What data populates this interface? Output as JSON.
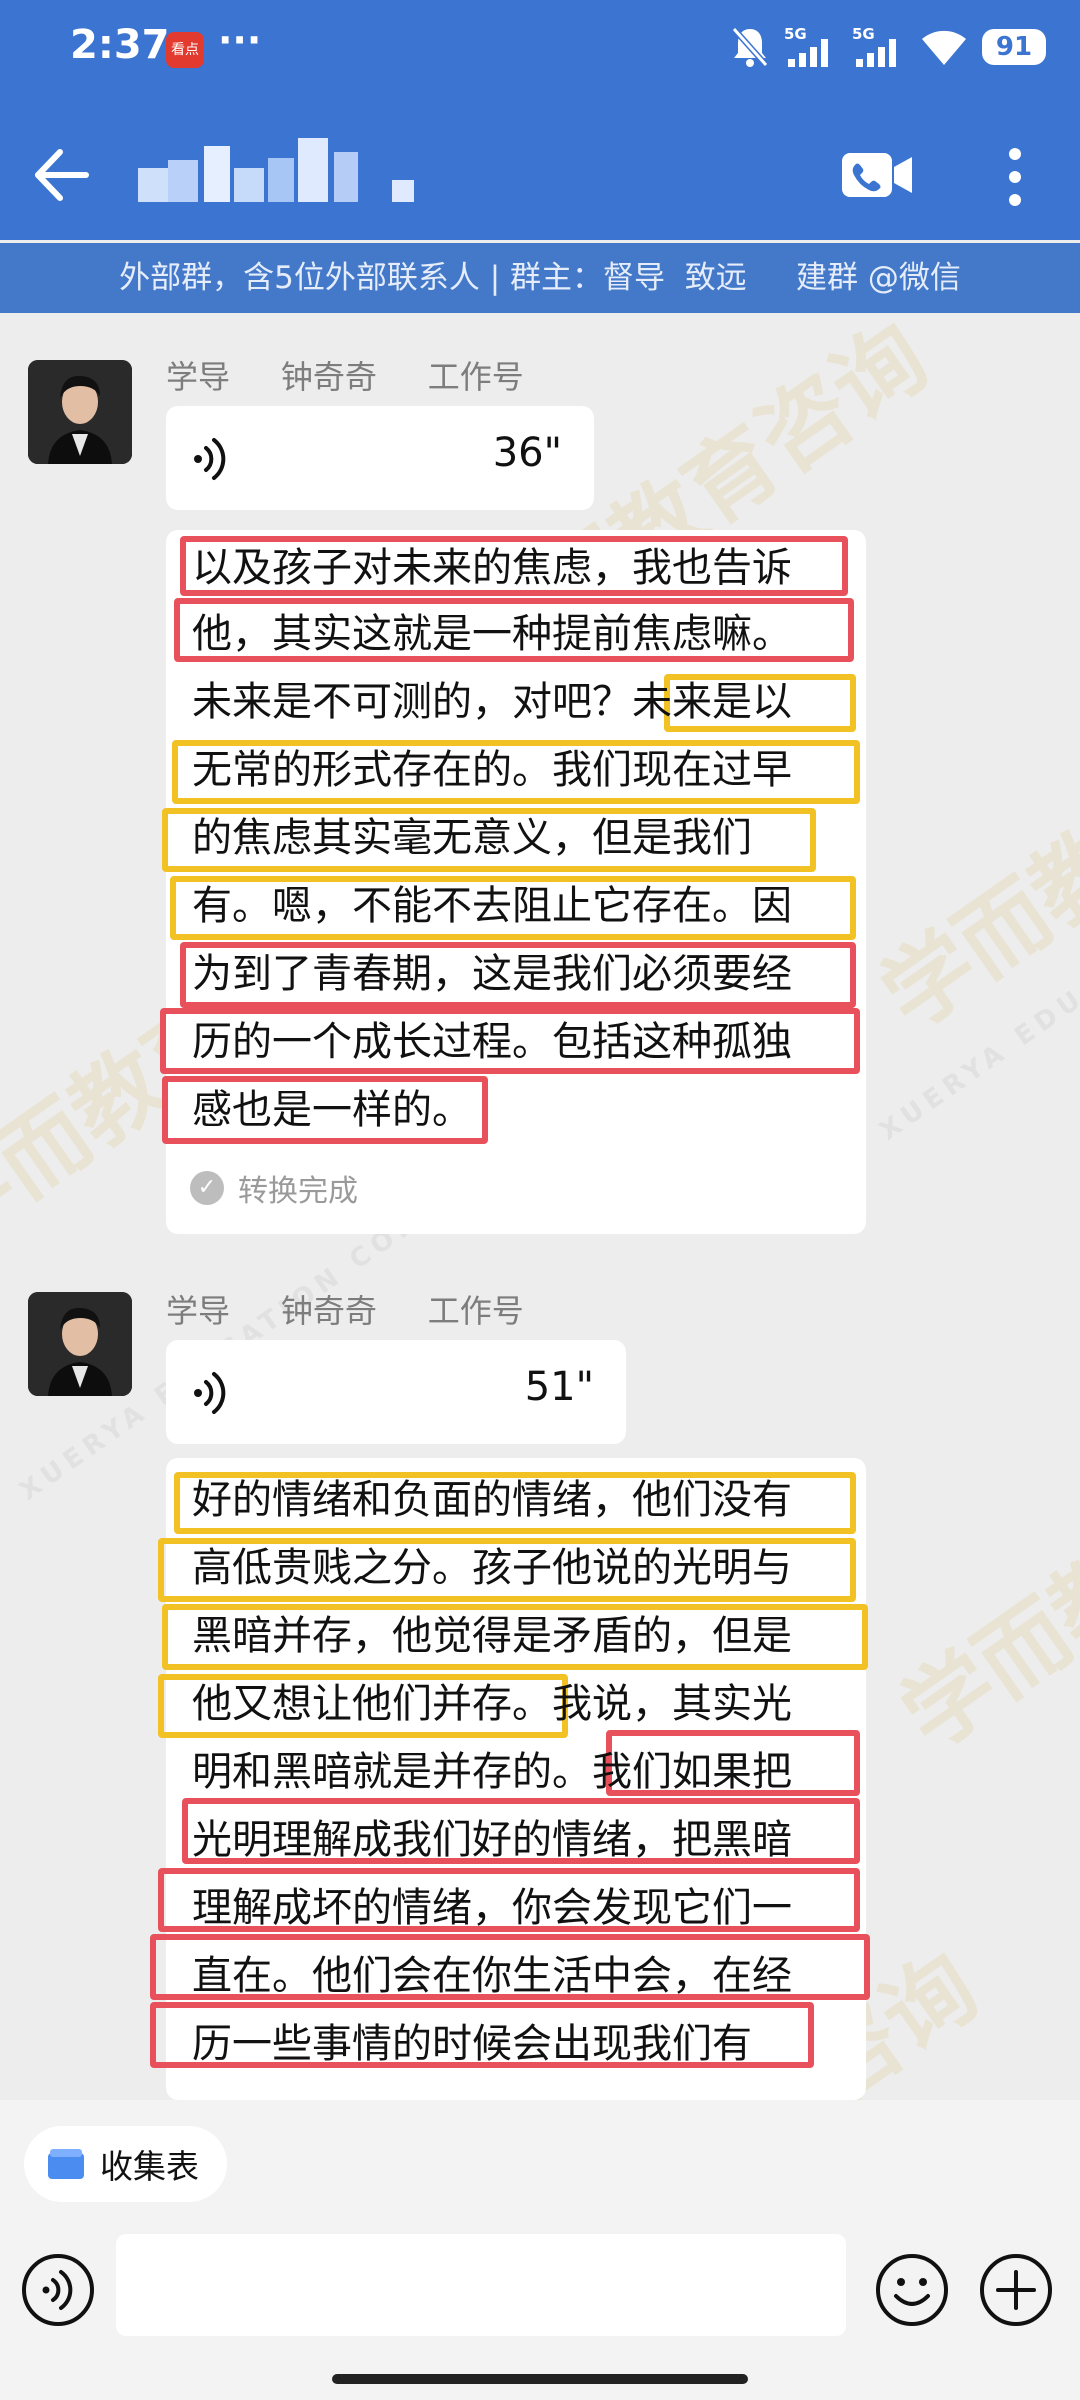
{
  "status_bar": {
    "time": "2:37",
    "app_icon_label": "看点",
    "more": "···",
    "signal1": "5G",
    "signal2": "5G",
    "battery": "91"
  },
  "header": {
    "title": "",
    "group_info": "外部群，含5位外部联系人 | 群主：督导  致远     建群 @微信"
  },
  "watermark": {
    "text": "学而教育咨询",
    "text_en": "XUERYA EDUCATION CONSULTATION"
  },
  "messages": [
    {
      "sender": "学导     钟奇奇     工作号",
      "voice_duration": "36\"",
      "transcript": [
        "以及孩子对未来的焦虑，我也告诉",
        "他，其实这就是一种提前焦虑嘛。",
        "未来是不可测的，对吧？未来是以",
        "无常的形式存在的。我们现在过早",
        "的焦虑其实毫无意义，但是我们",
        "有。嗯，不能不去阻止它存在。因",
        "为到了青春期，这是我们必须要经",
        "历的一个成长过程。包括这种孤独",
        "感也是一样的。"
      ],
      "status": "转换完成"
    },
    {
      "sender": "学导     钟奇奇     工作号",
      "voice_duration": "51\"",
      "transcript": [
        "好的情绪和负面的情绪，他们没有",
        "高低贵贱之分。孩子他说的光明与",
        "黑暗并存，他觉得是矛盾的，但是",
        "他又想让他们并存。我说，其实光",
        "明和黑暗就是并存的。我们如果把",
        "光明理解成我们好的情绪，把黑暗",
        "理解成坏的情绪，你会发现它们一",
        "直在。他们会在你生活中会，在经",
        "历一些事情的时候会出现我们有"
      ]
    }
  ],
  "bottom": {
    "collect_label": "收集表",
    "input_placeholder": ""
  },
  "colors": {
    "header_bg": "#3b74d1",
    "highlight_red": "#e8505b",
    "highlight_yellow": "#f2c224"
  }
}
